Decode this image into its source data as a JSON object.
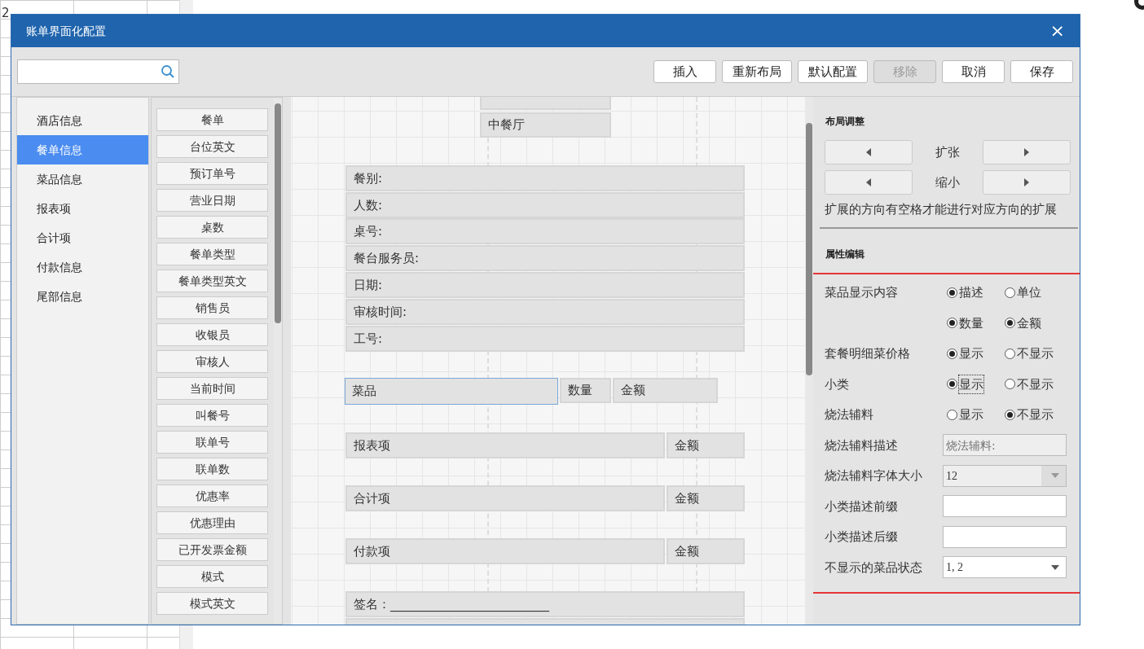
{
  "background_window": {
    "cells": [
      "2"
    ]
  },
  "dialog": {
    "title": "账单界面化配置",
    "close": "×"
  },
  "toolbar": [
    {
      "label": "插入",
      "disabled": false
    },
    {
      "label": "重新布局",
      "disabled": false
    },
    {
      "label": "默认配置",
      "disabled": false
    },
    {
      "label": "移除",
      "disabled": true
    },
    {
      "label": "取消",
      "disabled": false
    },
    {
      "label": "保存",
      "disabled": false
    }
  ],
  "categories": [
    {
      "label": "酒店信息",
      "selected": false
    },
    {
      "label": "餐单信息",
      "selected": true
    },
    {
      "label": "菜品信息",
      "selected": false
    },
    {
      "label": "报表项",
      "selected": false
    },
    {
      "label": "合计项",
      "selected": false
    },
    {
      "label": "付款信息",
      "selected": false
    },
    {
      "label": "尾部信息",
      "selected": false
    }
  ],
  "fields": [
    "餐单",
    "台位英文",
    "预订单号",
    "营业日期",
    "桌数",
    "餐单类型",
    "餐单类型英文",
    "销售员",
    "收银员",
    "审核人",
    "当前时间",
    "叫餐号",
    "联单号",
    "联单数",
    "优惠率",
    "优惠理由",
    "已开发票金额",
    "模式",
    "模式英文"
  ],
  "canvas": {
    "items": [
      {
        "selected": false
      },
      {
        "text": "中餐厅",
        "selected": false
      },
      {
        "text": "餐别:",
        "selected": false
      },
      {
        "text": "人数:",
        "selected": false
      },
      {
        "text": "桌号:",
        "selected": false
      },
      {
        "text": "餐台服务员:",
        "selected": false
      },
      {
        "text": "日期:",
        "selected": false
      },
      {
        "text": "审核时间:",
        "selected": false
      },
      {
        "text": "工号:",
        "selected": false
      },
      {
        "text": "菜品",
        "selected": true
      },
      {
        "text": "数量",
        "selected": false
      },
      {
        "text": "金额",
        "selected": false
      },
      {
        "text": "报表项",
        "selected": false
      },
      {
        "text": "金额",
        "selected": false
      },
      {
        "text": "合计项",
        "selected": false
      },
      {
        "text": "金额",
        "selected": false
      },
      {
        "text": "付款项",
        "selected": false
      },
      {
        "text": "金额",
        "selected": false
      },
      {
        "text": "签名：__________________________",
        "selected": false
      },
      {
        "selected": false
      }
    ]
  },
  "layout_adjust": {
    "title": "布局调整",
    "rows": [
      {
        "label": "扩张"
      },
      {
        "label": "缩小"
      }
    ],
    "note": "扩展的方向有空格才能进行对应方向的扩展"
  },
  "property_edit": {
    "title": "属性编辑",
    "rows": [
      {
        "kind": "options",
        "label": "菜品显示内容",
        "options": [
          {
            "label": "描述",
            "checked": true,
            "focused": false
          },
          {
            "label": "单位",
            "checked": false,
            "focused": false
          }
        ]
      },
      {
        "kind": "options",
        "options": [
          {
            "label": "数量",
            "checked": true,
            "focused": false
          },
          {
            "label": "金额",
            "checked": true,
            "focused": false
          }
        ]
      },
      {
        "kind": "options",
        "label": "套餐明细菜价格",
        "options": [
          {
            "label": "显示",
            "checked": true,
            "focused": false
          },
          {
            "label": "不显示",
            "checked": false,
            "focused": false
          }
        ]
      },
      {
        "kind": "options",
        "label": "小类",
        "options": [
          {
            "label": "显示",
            "checked": true,
            "focused": true
          },
          {
            "label": "不显示",
            "checked": false,
            "focused": false
          }
        ]
      },
      {
        "kind": "options",
        "label": "烧法辅料",
        "options": [
          {
            "label": "显示",
            "checked": false,
            "focused": false
          },
          {
            "label": "不显示",
            "checked": true,
            "focused": false
          }
        ]
      },
      {
        "kind": "text",
        "label": "烧法辅料描述",
        "placeholder": "烧法辅料:",
        "disabled": true
      },
      {
        "kind": "select",
        "label": "烧法辅料字体大小",
        "value": "12",
        "disabled": true
      },
      {
        "kind": "text",
        "label": "小类描述前缀",
        "disabled": false
      },
      {
        "kind": "text",
        "label": "小类描述后缀",
        "disabled": false
      },
      {
        "kind": "select",
        "label": "不显示的菜品状态",
        "value": "1, 2",
        "disabled": false
      }
    ]
  }
}
